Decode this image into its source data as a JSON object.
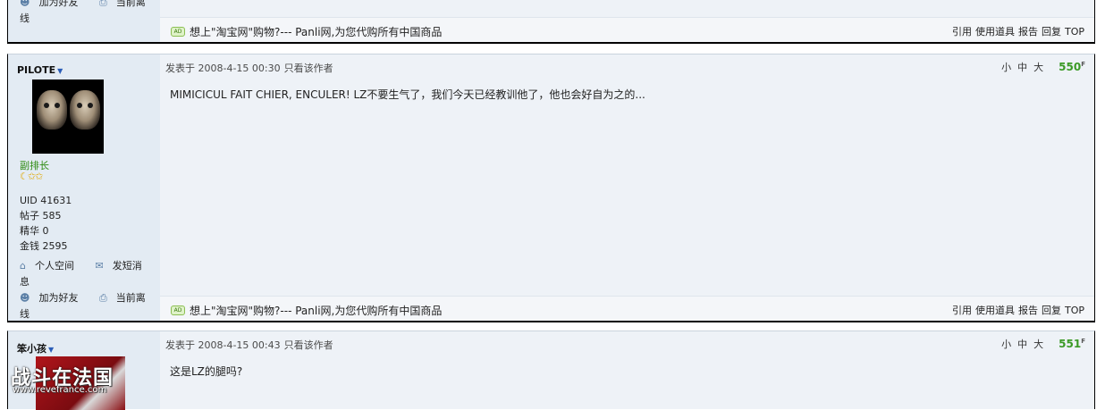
{
  "top_post": {
    "links": {
      "add_friend": "加为好友",
      "online_status": "当前离线"
    },
    "signature_ad": "想上\"淘宝网\"购物?--- Panli网,为您代购所有中国商品",
    "actions": [
      "引用",
      "使用道具",
      "报告",
      "回复",
      "TOP"
    ]
  },
  "post_550": {
    "username": "PILOTE",
    "rank": "副排长",
    "stars": "☾✩✩",
    "stats": [
      {
        "label": "UID",
        "value": "41631"
      },
      {
        "label": "帖子",
        "value": "585"
      },
      {
        "label": "精华",
        "value": "0"
      },
      {
        "label": "金钱",
        "value": "2595"
      }
    ],
    "links": {
      "space": "个人空间",
      "message": "发短消息",
      "add_friend": "加为好友",
      "online_status": "当前离线"
    },
    "meta": "发表于 2008-4-15 00:30",
    "only_author": "只看该作者",
    "font_sizes": [
      "小",
      "中",
      "大"
    ],
    "floor": "550",
    "floor_sup": "F",
    "content": "MIMICICUL FAIT CHIER, ENCULER! LZ不要生气了，我们今天已经教训他了，他也会好自为之的...",
    "signature_ad": "想上\"淘宝网\"购物?--- Panli网,为您代购所有中国商品",
    "actions": [
      "引用",
      "使用道具",
      "报告",
      "回复",
      "TOP"
    ]
  },
  "post_551": {
    "username": "笨小孩",
    "meta": "发表于 2008-4-15 00:43",
    "only_author": "只看该作者",
    "font_sizes": [
      "小",
      "中",
      "大"
    ],
    "floor": "551",
    "floor_sup": "F",
    "content": "这是LZ的腿吗?"
  },
  "watermark": {
    "title": "战斗在法国",
    "url": "www.revefrance.com"
  },
  "colors": {
    "sidebar": "#e3ebf3",
    "main": "#eef2f7",
    "floor": "#3b9a26",
    "rank": "#2e8b12"
  }
}
